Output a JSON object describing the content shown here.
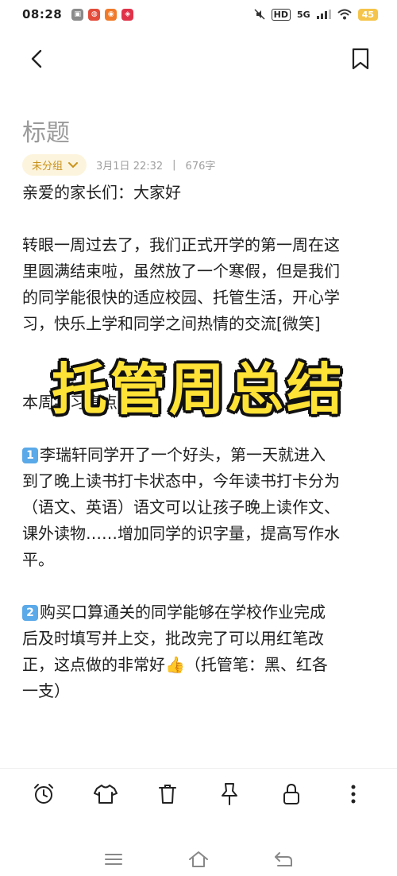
{
  "status_bar": {
    "time": "08:28",
    "network": "5G",
    "hd": "HD",
    "battery": "45"
  },
  "note": {
    "title": "标题",
    "group": "未分组",
    "date": "3月1日 22:32",
    "separator": "|",
    "word_count": "676字"
  },
  "banner": {
    "text": "托管周总结"
  },
  "content": {
    "greeting": "亲爱的家长们：大家好",
    "intro_line1": "转眼一周过去了，我们正式开学的第一周在这",
    "intro_line2": "里圆满结束啦，虽然放了一个寒假，但是我们",
    "intro_line3": "的同学能很快的适应校园、托管生活，开心学",
    "intro_line4": "习，快乐上学和同学之间热情的交流[微笑]",
    "highlights_title": "本周学习亮点：",
    "item1_badge": "1",
    "item1_line1": "李瑞轩同学开了一个好头，第一天就进入",
    "item1_line2": "到了晚上读书打卡状态中，今年读书打卡分为",
    "item1_line3": "（语文、英语）语文可以让孩子晚上读作文、",
    "item1_line4": "课外读物……增加同学的识字量，提高写作水",
    "item1_line5": "平。",
    "item2_badge": "2",
    "item2_line1": "购买口算通关的同学能够在学校作业完成",
    "item2_line2": "后及时填写并上交，批改完了可以用红笔改",
    "item2_line3": "正，这点做的非常好👍（托管笔：黑、红各",
    "item2_line4": "一支）"
  },
  "toolbar": {
    "items": [
      "alarm-icon",
      "shirt-icon",
      "trash-icon",
      "pin-icon",
      "lock-icon",
      "more-icon"
    ]
  },
  "colors": {
    "accent": "#c9921a",
    "chip_bg": "#fdf4dd",
    "banner_fill": "#ffe236",
    "title_gray": "#9a9a9a"
  }
}
